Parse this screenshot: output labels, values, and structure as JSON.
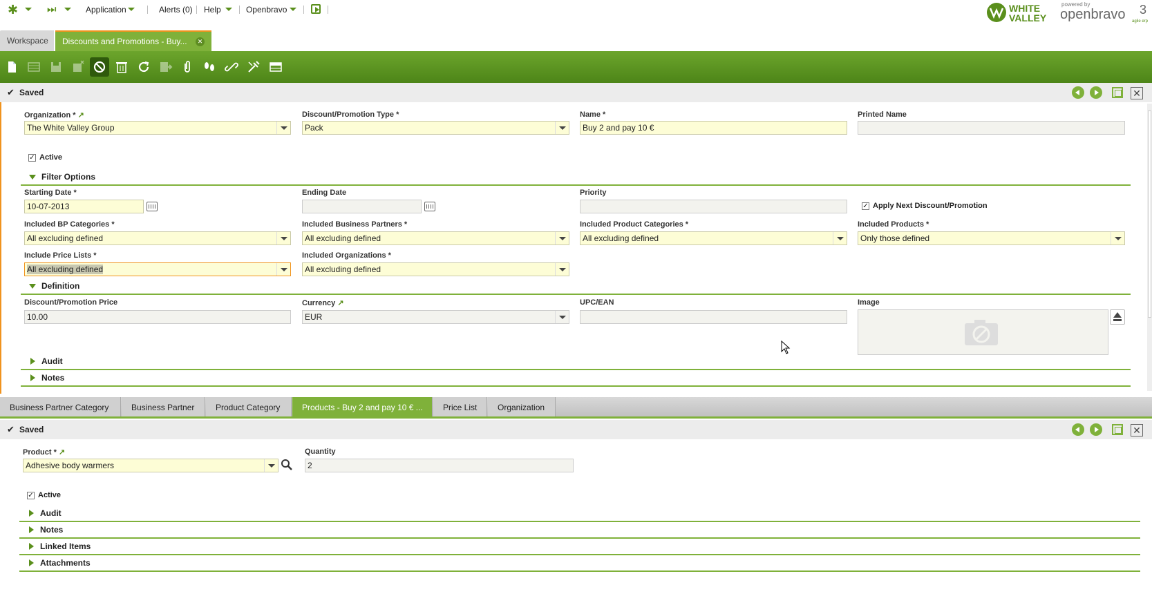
{
  "topnav": {
    "application": "Application",
    "alerts": "Alerts (0)",
    "help": "Help",
    "openbravo": "Openbravo"
  },
  "logos": {
    "wv_line1": "WHITE",
    "wv_line2": "VALLEY",
    "ob_powered": "powered by",
    "ob_name": "openbravo",
    "ob_version": "3",
    "ob_tagline": "agile erp"
  },
  "main_tabs": [
    {
      "label": "Workspace"
    },
    {
      "label": "Discounts and Promotions - Buy..."
    }
  ],
  "status": {
    "saved": "Saved"
  },
  "header_form": {
    "organization": {
      "label": "Organization *",
      "value": "The White Valley Group"
    },
    "discount_type": {
      "label": "Discount/Promotion Type *",
      "value": "Pack"
    },
    "name": {
      "label": "Name *",
      "value": "Buy 2 and pay 10 €"
    },
    "printed_name": {
      "label": "Printed Name",
      "value": ""
    },
    "active": {
      "label": "Active",
      "checked": true
    }
  },
  "filter_options": {
    "title": "Filter Options",
    "starting_date": {
      "label": "Starting Date *",
      "value": "10-07-2013"
    },
    "ending_date": {
      "label": "Ending Date",
      "value": ""
    },
    "priority": {
      "label": "Priority",
      "value": ""
    },
    "apply_next": {
      "label": "Apply Next Discount/Promotion",
      "checked": true
    },
    "bp_categories": {
      "label": "Included BP Categories *",
      "value": "All excluding defined"
    },
    "business_partners": {
      "label": "Included Business Partners *",
      "value": "All excluding defined"
    },
    "product_categories": {
      "label": "Included Product Categories *",
      "value": "All excluding defined"
    },
    "products": {
      "label": "Included Products *",
      "value": "Only those defined"
    },
    "price_lists": {
      "label": "Include Price Lists *",
      "value": "All excluding defined"
    },
    "organizations": {
      "label": "Included Organizations *",
      "value": "All excluding defined"
    }
  },
  "definition": {
    "title": "Definition",
    "price": {
      "label": "Discount/Promotion Price",
      "value": "10.00"
    },
    "currency": {
      "label": "Currency",
      "value": "EUR"
    },
    "upc": {
      "label": "UPC/EAN",
      "value": ""
    },
    "image": {
      "label": "Image"
    }
  },
  "sections1": {
    "audit": "Audit",
    "notes": "Notes"
  },
  "sub_tabs": [
    {
      "label": "Business Partner Category"
    },
    {
      "label": "Business Partner"
    },
    {
      "label": "Product Category"
    },
    {
      "label": "Products - Buy 2 and pay 10 € ..."
    },
    {
      "label": "Price List"
    },
    {
      "label": "Organization"
    }
  ],
  "line_form": {
    "product": {
      "label": "Product *",
      "value": "Adhesive body warmers"
    },
    "quantity": {
      "label": "Quantity",
      "value": "2"
    },
    "active": {
      "label": "Active",
      "checked": true
    }
  },
  "sections2": {
    "audit": "Audit",
    "notes": "Notes",
    "linked_items": "Linked Items",
    "attachments": "Attachments"
  },
  "colors": {
    "accent": "#7fb13a",
    "toolbar": "#5a952a",
    "focus": "#f0931e",
    "mandatory_bg": "#fdfdd6"
  }
}
